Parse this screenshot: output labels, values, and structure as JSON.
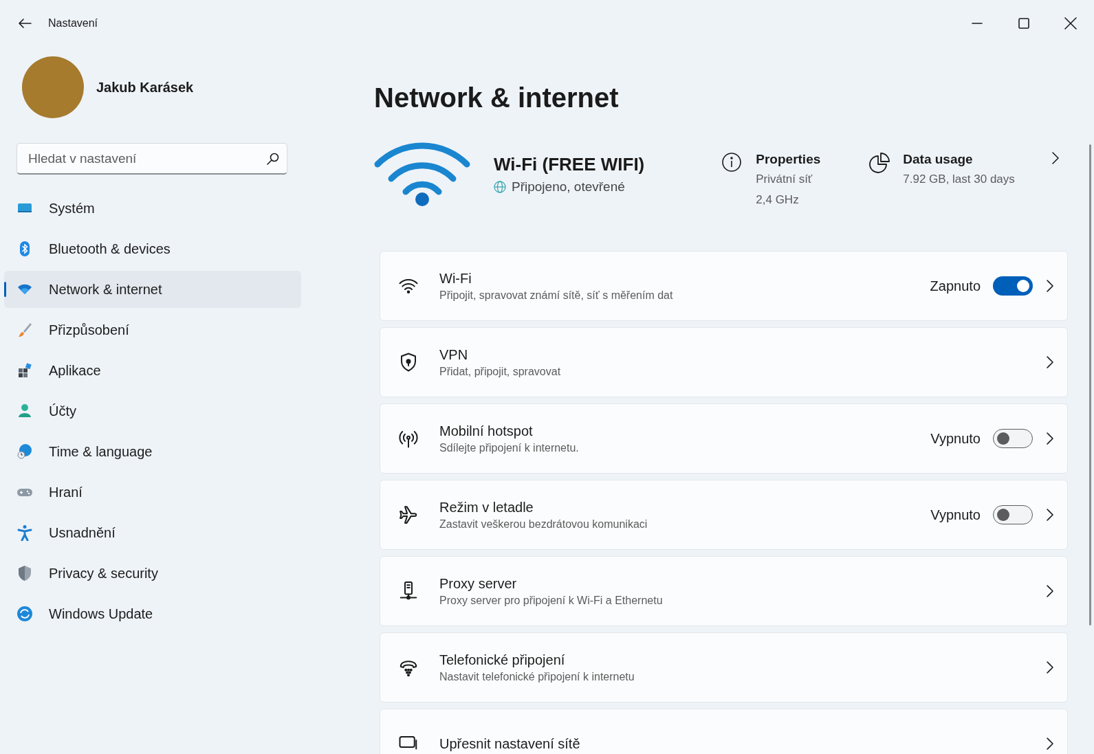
{
  "window": {
    "title": "Nastavení"
  },
  "user": {
    "name": "Jakub Karásek"
  },
  "search": {
    "placeholder": "Hledat v nastavení"
  },
  "sidebar": {
    "items": [
      {
        "label": "Systém",
        "selected": false
      },
      {
        "label": "Bluetooth & devices",
        "selected": false
      },
      {
        "label": "Network & internet",
        "selected": true
      },
      {
        "label": "Přizpůsobení",
        "selected": false
      },
      {
        "label": "Aplikace",
        "selected": false
      },
      {
        "label": "Účty",
        "selected": false
      },
      {
        "label": "Time & language",
        "selected": false
      },
      {
        "label": "Hraní",
        "selected": false
      },
      {
        "label": "Usnadnění",
        "selected": false
      },
      {
        "label": "Privacy & security",
        "selected": false
      },
      {
        "label": "Windows Update",
        "selected": false
      }
    ]
  },
  "page": {
    "title": "Network & internet"
  },
  "connection": {
    "name": "Wi-Fi (FREE WIFI)",
    "status": "Připojeno, otevřené",
    "properties": {
      "title": "Properties",
      "lines": [
        "Privátní síť",
        "2,4 GHz"
      ]
    },
    "data_usage": {
      "title": "Data usage",
      "detail": "7.92 GB, last 30 days"
    }
  },
  "settings": [
    {
      "kind": "toggle",
      "title": "Wi-Fi",
      "subtitle": "Připojit, spravovat známí sítě, síť s měřením dat",
      "state_label": "Zapnuto",
      "on": true
    },
    {
      "kind": "link",
      "title": "VPN",
      "subtitle": "Přidat, připojit, spravovat"
    },
    {
      "kind": "toggle",
      "title": "Mobilní hotspot",
      "subtitle": "Sdílejte připojení k internetu.",
      "state_label": "Vypnuto",
      "on": false
    },
    {
      "kind": "toggle",
      "title": "Režim v letadle",
      "subtitle": "Zastavit veškerou bezdrátovou komunikaci",
      "state_label": "Vypnuto",
      "on": false
    },
    {
      "kind": "link",
      "title": "Proxy server",
      "subtitle": "Proxy server pro připojení k Wi-Fi a Ethernetu"
    },
    {
      "kind": "link",
      "title": "Telefonické připojení",
      "subtitle": "Nastavit telefonické připojení k internetu"
    },
    {
      "kind": "link",
      "title": "Upřesnit nastavení sítě"
    }
  ]
}
